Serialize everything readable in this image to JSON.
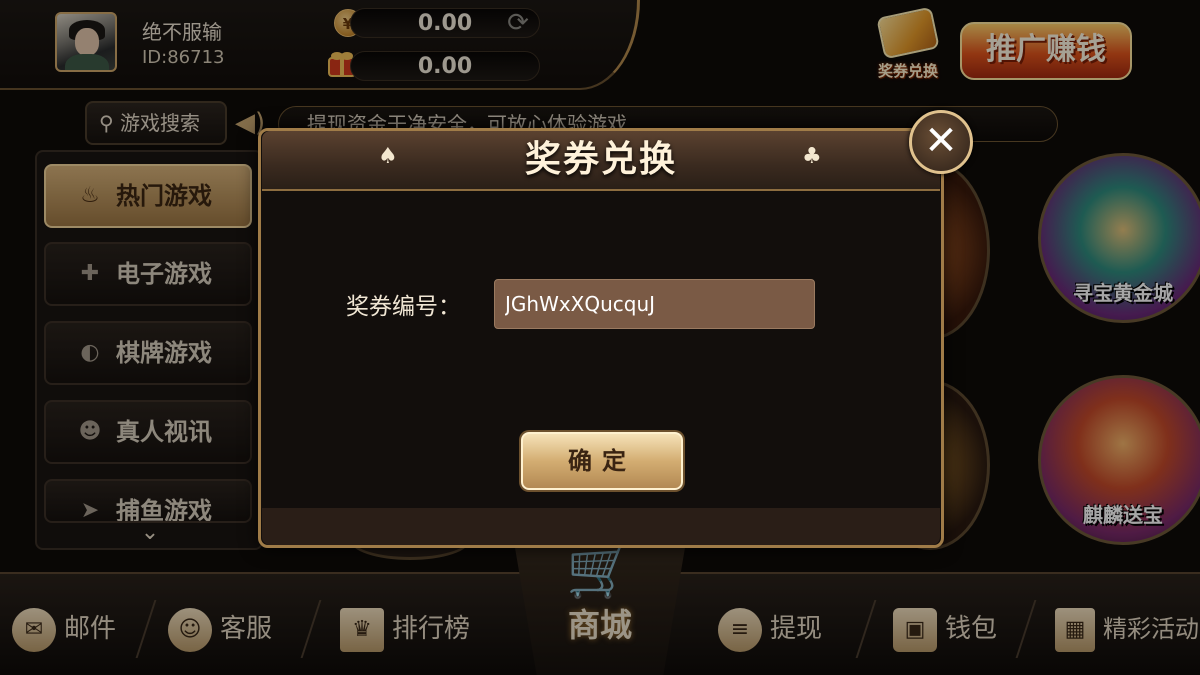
{
  "user": {
    "name": "绝不服输",
    "id": "ID:86713"
  },
  "balances": {
    "cash": "0.00",
    "bonus": "0.00",
    "coin_symbol": "¥"
  },
  "header": {
    "voucher_exchange_label": "奖券兑换",
    "promo_label": "推广赚钱"
  },
  "search": {
    "label": "游戏搜索"
  },
  "marquee": {
    "text": "提现资金干净安全，可放心体验游戏"
  },
  "sidebar": {
    "items": [
      {
        "label": "热门游戏",
        "active": true
      },
      {
        "label": "电子游戏",
        "active": false
      },
      {
        "label": "棋牌游戏",
        "active": false
      },
      {
        "label": "真人视讯",
        "active": false
      },
      {
        "label": "捕鱼游戏",
        "active": false
      }
    ]
  },
  "games": [
    {
      "label": "寻宝黄金城"
    },
    {
      "label": "麒麟送宝"
    }
  ],
  "bottom_nav": {
    "mail": "邮件",
    "service": "客服",
    "ranking": "排行榜",
    "shop": "商城",
    "withdraw": "提现",
    "wallet": "钱包",
    "events": "精彩活动"
  },
  "modal": {
    "title": "奖券兑换",
    "field_label": "奖券编号：",
    "field_value": "JGhWxXQucquJ",
    "confirm_label": "确定",
    "close_symbol": "✕"
  },
  "colors": {
    "gold": "#d3ad72",
    "background": "#0e0b09",
    "input_bg": "#7a5a45"
  }
}
